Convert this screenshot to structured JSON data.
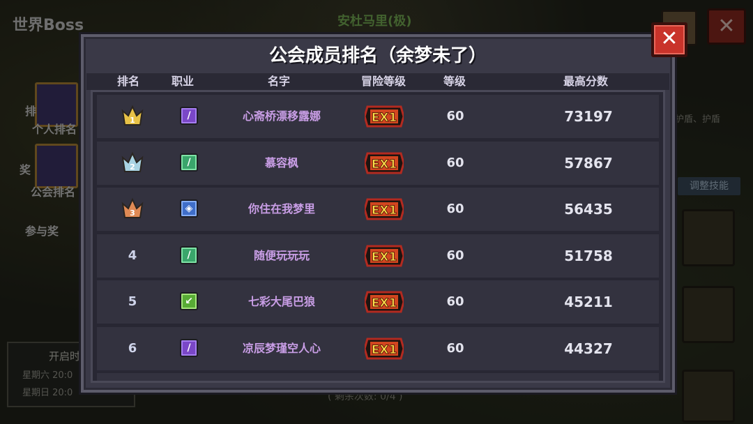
{
  "background": {
    "title": "世界Boss",
    "boss_name": "安杜马里(极)",
    "left_items": [
      "排",
      "个人排名",
      "奖",
      "公会排名",
      "参与奖"
    ],
    "info_title": "开启时",
    "info_lines": [
      "星期六 20:0",
      "星期日 20:0"
    ],
    "right_text": "护盾、护盾",
    "adjust_skill": "调整技能",
    "bottom_text": "( 剩余次数: 0/4 )",
    "close_glyph": "✕"
  },
  "dialog": {
    "title": "公会成员排名（余梦未了）",
    "close_glyph": "✕",
    "headers": {
      "rank": "排名",
      "job": "职业",
      "name": "名字",
      "adventure_level": "冒险等级",
      "level": "等级",
      "high_score": "最高分数"
    },
    "rows": [
      {
        "rank": "1",
        "crown": "gold",
        "job": "purple",
        "job_icon": "dagger-icon",
        "name": "心斋桥漂移露娜",
        "adventure": "EX1",
        "level": "60",
        "score": "73197"
      },
      {
        "rank": "2",
        "crown": "silver",
        "job": "green",
        "job_icon": "sword-icon",
        "name": "慕容枫",
        "adventure": "EX1",
        "level": "60",
        "score": "57867"
      },
      {
        "rank": "3",
        "crown": "bronze",
        "job": "blue",
        "job_icon": "shield-icon",
        "name": "你住在我梦里",
        "adventure": "EX1",
        "level": "60",
        "score": "56435"
      },
      {
        "rank": "4",
        "crown": "",
        "job": "green",
        "job_icon": "sword-icon",
        "name": "随便玩玩玩",
        "adventure": "EX1",
        "level": "60",
        "score": "51758"
      },
      {
        "rank": "5",
        "crown": "",
        "job": "lime",
        "job_icon": "bow-icon",
        "name": "七彩大尾巴狼",
        "adventure": "EX1",
        "level": "60",
        "score": "45211"
      },
      {
        "rank": "6",
        "crown": "",
        "job": "purple",
        "job_icon": "dagger-icon",
        "name": "凉辰梦瑾空人心",
        "adventure": "EX1",
        "level": "60",
        "score": "44327"
      }
    ]
  },
  "colors": {
    "name_purple": "#c99ee6",
    "crown_gold": "#e8c247",
    "crown_silver": "#a9d3e3",
    "crown_bronze": "#e08a55",
    "close_red": "#c9332a"
  }
}
